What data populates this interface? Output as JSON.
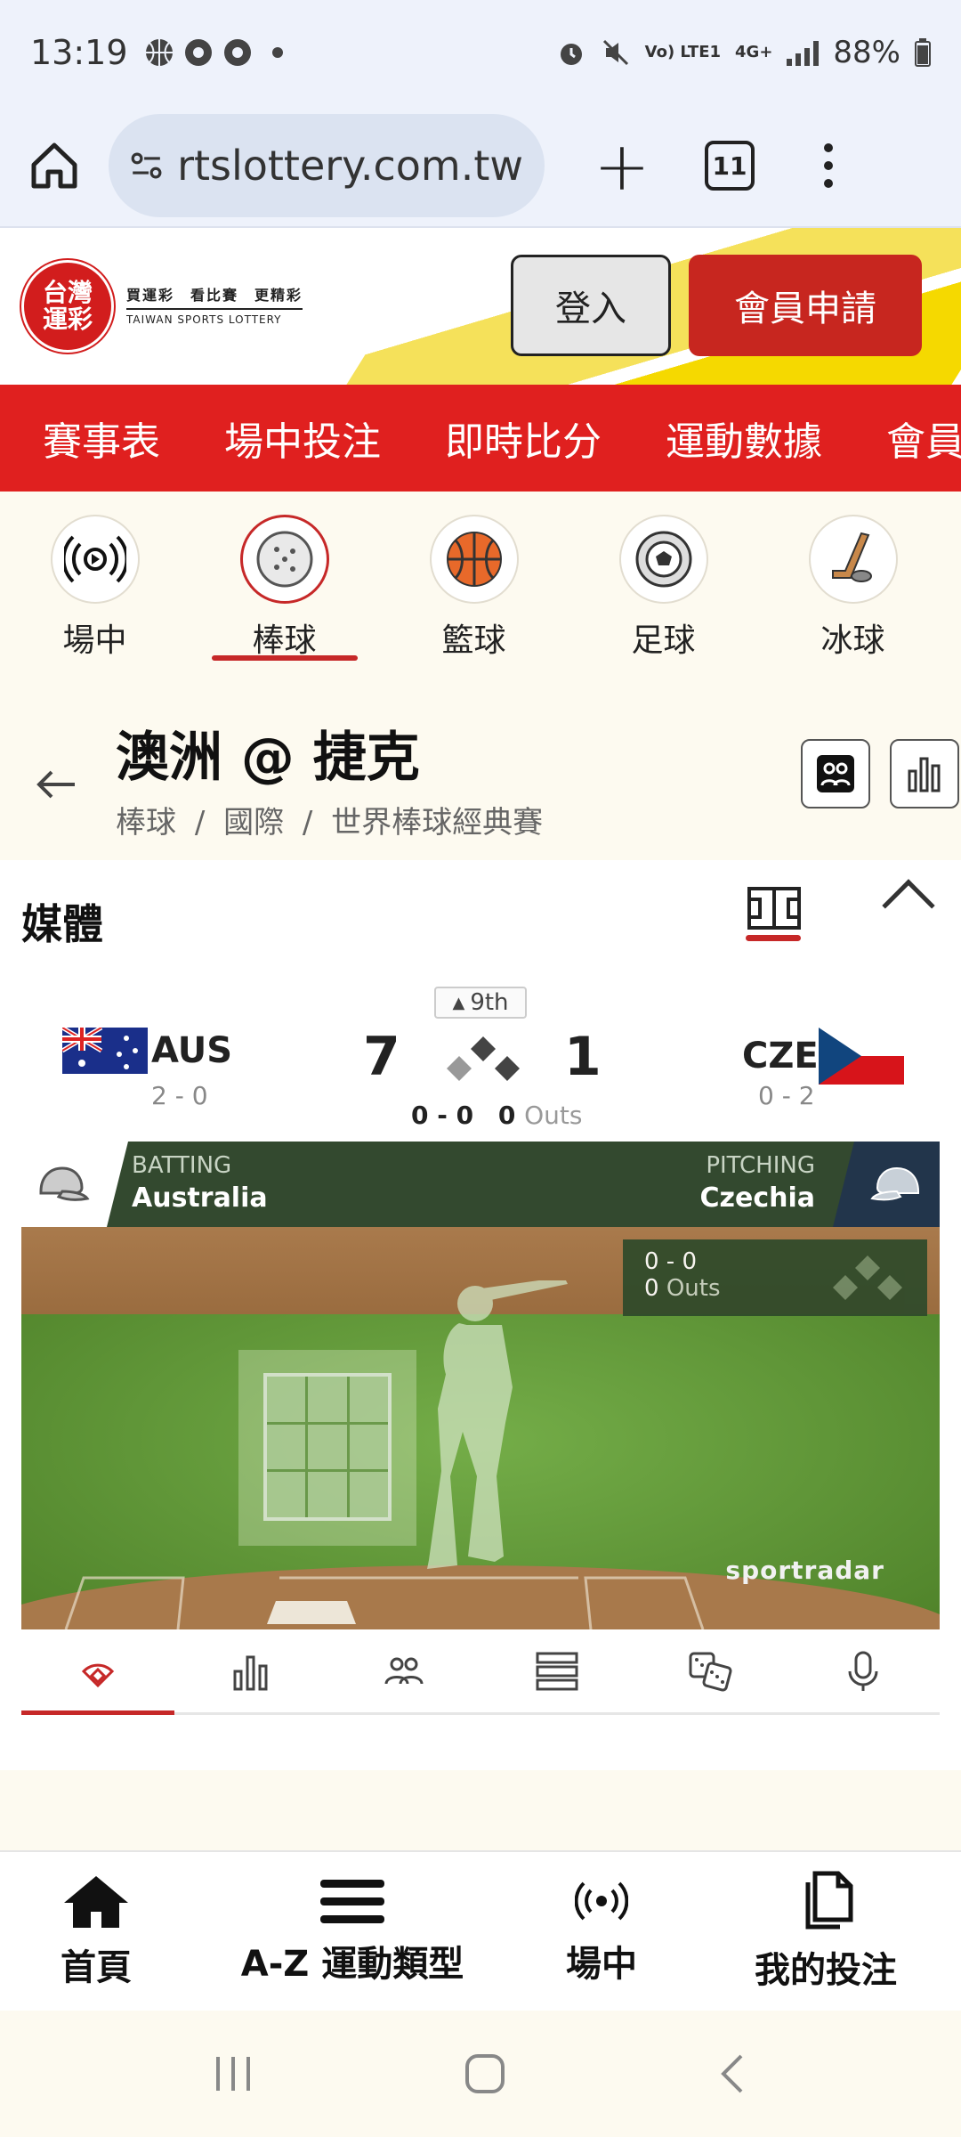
{
  "status_bar": {
    "time": "13:19",
    "network": "Vo) LTE1",
    "network_type": "4G+",
    "battery": "88%",
    "icons": [
      "basketball-icon",
      "chrome-icon",
      "chrome-icon",
      "dot-icon",
      "alarm-icon",
      "mute-icon",
      "signal-icon",
      "battery-icon"
    ]
  },
  "browser": {
    "url": "rtslottery.com.tw",
    "tab_count": "11"
  },
  "site_header": {
    "logo_text": "台灣運彩",
    "tagline": "買運彩　看比賽　更精彩",
    "subtitle": "TAIWAN SPORTS LOTTERY",
    "login_label": "登入",
    "register_label": "會員申請",
    "accent_color": "#e0201f"
  },
  "main_nav": [
    "賽事表",
    "場中投注",
    "即時比分",
    "運動數據",
    "會員"
  ],
  "sport_tabs": [
    {
      "label": "場中",
      "icon": "live-icon",
      "active": false
    },
    {
      "label": "棒球",
      "icon": "baseball-icon",
      "active": true
    },
    {
      "label": "籃球",
      "icon": "basketball-icon",
      "active": false
    },
    {
      "label": "足球",
      "icon": "soccer-icon",
      "active": false
    },
    {
      "label": "冰球",
      "icon": "hockey-icon",
      "active": false
    }
  ],
  "match": {
    "title": "澳洲 @ 捷克",
    "breadcrumb": [
      "棒球",
      "國際",
      "世界棒球經典賽"
    ]
  },
  "media": {
    "title": "媒體",
    "inning": "9th",
    "home": {
      "code": "AUS",
      "record": "2 - 0",
      "score": "7"
    },
    "away": {
      "code": "CZE",
      "record": "0 - 2",
      "score": "1"
    },
    "count": "0 - 0",
    "outs_value": "0",
    "outs_label": "Outs",
    "batting_label": "BATTING",
    "batting_team": "Australia",
    "pitching_label": "PITCHING",
    "pitching_team": "Czechia",
    "overlay_count": "0 - 0",
    "overlay_outs_value": "0",
    "overlay_outs_label": "Outs",
    "provider": "sportradar"
  },
  "widget_tabs": [
    "field-icon",
    "stats-icon",
    "lineup-icon",
    "list-icon",
    "dice-icon",
    "mic-icon"
  ],
  "app_nav": [
    {
      "label": "首頁",
      "icon": "home-icon"
    },
    {
      "label": "A-Z 運動類型",
      "icon": "menu-icon"
    },
    {
      "label": "場中",
      "icon": "live-icon"
    },
    {
      "label": "我的投注",
      "icon": "betslip-icon"
    }
  ]
}
